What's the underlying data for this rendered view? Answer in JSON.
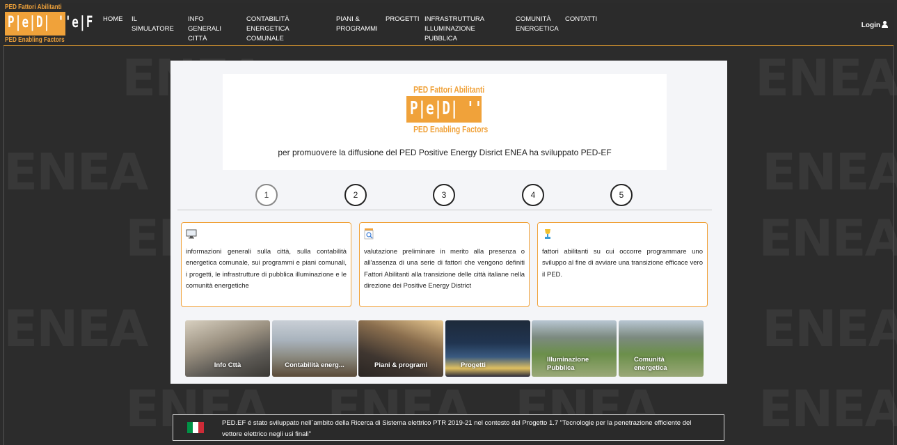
{
  "logo": {
    "line1": "PED Fattori Abilitanti",
    "mark": "P|e|D| ''e|F",
    "line2": "PED Enabling Factors"
  },
  "nav": {
    "items": [
      {
        "label": "HOME"
      },
      {
        "label": "IL SIMULATORE"
      },
      {
        "label": "INFO GENERALI\nCITTÀ"
      },
      {
        "label": "CONTABILITÀ ENERGETICA\nCOMUNALE"
      },
      {
        "label": "PIANI &\nPROGRAMMI"
      },
      {
        "label": "PROGETTI"
      },
      {
        "label": "INFRASTRUTTURA\nILLUMINAZIONE PUBBLICA"
      },
      {
        "label": "COMUNITÀ\nENERGETICA"
      },
      {
        "label": "CONTATTI"
      }
    ],
    "login_label": "Login"
  },
  "watermark": "ENEA",
  "hero": {
    "logo_line1": "PED Fattori Abilitanti",
    "logo_mark": "P|e|D| ''e|F",
    "logo_line2": "PED Enabling Factors",
    "tagline": "per promuovere la diffusione del PED Positive Energy Disrict ENEA ha sviluppato PED-EF"
  },
  "steps": [
    "1",
    "2",
    "3",
    "4",
    "5"
  ],
  "cards": [
    {
      "icon": "monitor-icon",
      "text": "informazioni generali sulla città, sulla contabilità energetica comunale, sui programmi e piani comunali, i progetti, le infrastrutture di pubblica illuminazione e le comunità energetiche"
    },
    {
      "icon": "magnifier-document-icon",
      "text": "valutazione preliminare in merito alla presenza o all'assenza di una serie di fattori che vengono definiti Fattori Abilitanti alla transizione delle città italiane nella direzione dei Positive Energy District"
    },
    {
      "icon": "trophy-icon",
      "text": "fattori abilitanti su cui occorre programmare uno sviluppo al fine di avviare una transizione efficace vero il PED."
    }
  ],
  "tiles": [
    {
      "label": "Info Cttà"
    },
    {
      "label": "Contabilità energ..."
    },
    {
      "label": "Piani & programi"
    },
    {
      "label": "Progetti"
    },
    {
      "label": "Illuminazione Pubblica"
    },
    {
      "label": "Comunità energetica"
    }
  ],
  "footer": {
    "flag_colors": [
      "#009246",
      "#ffffff",
      "#ce2b37"
    ],
    "text": "PED.EF é stato sviluppato nell´ambito della Ricerca di Sistema elettrico PTR 2019-21 nel contesto del Progetto 1.7 \"Tecnologie per la penetrazione efficiente del vettore elettrico negli usi finali\""
  },
  "colors": {
    "accent": "#f0a23a",
    "background": "#2c2c2c",
    "panel": "#f4f5f8"
  }
}
